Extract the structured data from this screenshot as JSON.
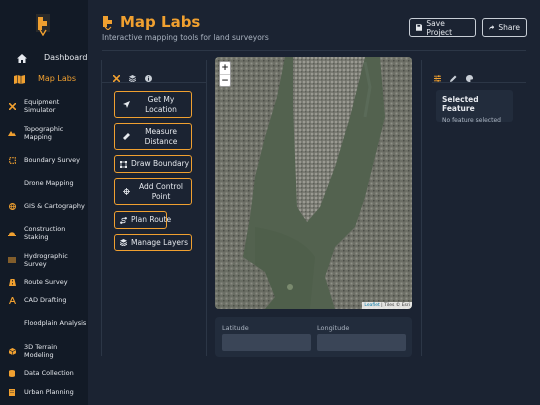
{
  "sidebar": {
    "items": [
      {
        "label": "Dashboard",
        "icon": "home-icon"
      },
      {
        "label": "Map Labs",
        "icon": "map-icon",
        "active": true
      },
      {
        "label": "Equipment Simulator",
        "icon": "tools-icon"
      },
      {
        "label": "Topographic Mapping",
        "icon": "mountain-icon"
      },
      {
        "label": "Boundary Survey",
        "icon": "boundary-icon"
      },
      {
        "label": "Drone Mapping",
        "icon": "drone-icon"
      },
      {
        "label": "GIS & Cartography",
        "icon": "globe-icon"
      },
      {
        "label": "Construction Staking",
        "icon": "hardhat-icon"
      },
      {
        "label": "Hydrographic Survey",
        "icon": "water-icon"
      },
      {
        "label": "Route Survey",
        "icon": "road-icon"
      },
      {
        "label": "CAD Drafting",
        "icon": "compass-icon"
      },
      {
        "label": "Floodplain Analysis",
        "icon": "flood-icon"
      },
      {
        "label": "3D Terrain Modeling",
        "icon": "cube-icon"
      },
      {
        "label": "Data Collection",
        "icon": "database-icon"
      },
      {
        "label": "Urban Planning",
        "icon": "building-icon"
      }
    ]
  },
  "header": {
    "title": "Map Labs",
    "subtitle": "Interactive mapping tools for land surveyors",
    "save_label": "Save Project",
    "share_label": "Share"
  },
  "tools": {
    "tabs": [
      "tools-icon",
      "layers-icon",
      "info-icon"
    ],
    "buttons": [
      {
        "label": "Get My Location",
        "icon": "location-arrow-icon"
      },
      {
        "label": "Measure Distance",
        "icon": "ruler-icon"
      },
      {
        "label": "Draw Boundary",
        "icon": "vector-square-icon"
      },
      {
        "label": "Add Control Point",
        "icon": "crosshair-icon"
      },
      {
        "label": "Plan Route",
        "icon": "route-icon"
      },
      {
        "label": "Manage Layers",
        "icon": "layers-icon"
      }
    ]
  },
  "map": {
    "zoom_in": "+",
    "zoom_out": "−",
    "attribution_leaflet": "Leaflet",
    "attribution_rest": "| Tiles © Esri"
  },
  "coords": {
    "latitude_label": "Latitude",
    "longitude_label": "Longitude"
  },
  "properties": {
    "tabs": [
      "sliders-icon",
      "pen-icon",
      "palette-icon"
    ],
    "feature_title": "Selected Feature",
    "feature_text": "No feature selected"
  },
  "colors": {
    "accent": "#f0a030",
    "background": "#1b2332",
    "sidebar": "#121a26"
  }
}
